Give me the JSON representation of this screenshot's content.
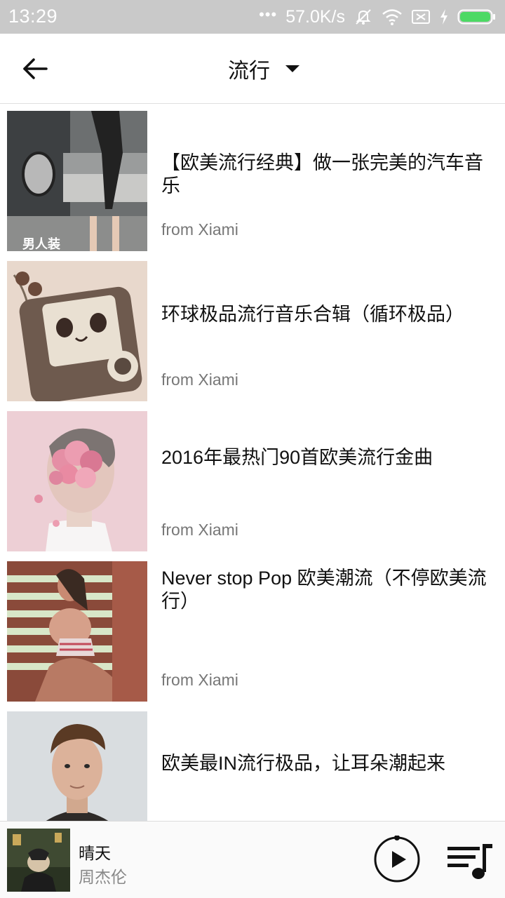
{
  "status_bar": {
    "time": "13:29",
    "dots": "•••",
    "network_speed": "57.0K/s",
    "icons": [
      "mute-icon",
      "wifi-icon",
      "no-sim-icon",
      "charging-icon",
      "battery-icon"
    ],
    "battery_color": "#4cd964"
  },
  "header": {
    "back_icon": "back-arrow-icon",
    "title": "流行",
    "dropdown_icon": "caret-down-icon"
  },
  "playlists": [
    {
      "title": "【欧美流行经典】做一张完美的汽车音乐",
      "source": "from Xiami"
    },
    {
      "title": "环球极品流行音乐合辑（循环极品）",
      "source": "from Xiami"
    },
    {
      "title": "2016年最热门90首欧美流行金曲",
      "source": "from Xiami"
    },
    {
      "title": "Never stop Pop 欧美潮流（不停欧美流行）",
      "source": "from Xiami"
    },
    {
      "title": "欧美最IN流行极品，让耳朵潮起来",
      "source": ""
    }
  ],
  "player": {
    "song_title": "晴天",
    "artist": "周杰伦",
    "play_icon": "play-icon",
    "queue_icon": "playlist-queue-icon"
  },
  "colors": {
    "status_bar_bg": "#c9c9c9",
    "text_primary": "#111111",
    "text_secondary": "#777777"
  }
}
